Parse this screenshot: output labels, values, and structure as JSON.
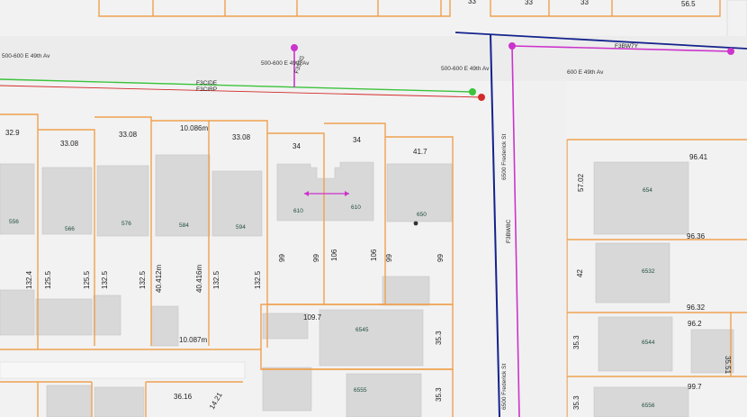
{
  "streets": {
    "e49_left": "500-600 E 49th Av",
    "e49_mid": "500-600 E 49th Av",
    "e49_right": "600 E 49th Av",
    "frederick_north": "6500 Frederick St",
    "frederick_south": "6500 Frederick St"
  },
  "lines": {
    "green_label": "F3CIDE",
    "red_label": "F3CIRP",
    "magenta_label_left": "F3S3G",
    "magenta_label_right": "F3BW7Y",
    "magenta_vertical_label": "F3BW8C",
    "green_color": "#3cc33c",
    "red_color": "#d42a2a",
    "magenta_color": "#cc33cc",
    "navy_color": "#14238c",
    "lot_color": "#f0a14f"
  },
  "addresses": {
    "a556": "556",
    "a566": "566",
    "a576": "576",
    "a584": "584",
    "a594": "594",
    "a610a": "610",
    "a610b": "610",
    "a650": "650",
    "a6545": "6545",
    "a6555": "6555",
    "a654": "654",
    "a6532": "6532",
    "a6544": "6544",
    "a6556": "6556"
  },
  "dimensions": {
    "top_33": "33",
    "top_33b": "33",
    "top_33c": "33",
    "top_565": "56.5",
    "d329": "32.9",
    "d3308a": "33.08",
    "d3308b": "33.08",
    "d10086": "10.086m",
    "d3308c": "33.08",
    "d34a": "34",
    "d34b": "34",
    "d417": "41.7",
    "d1324": "132.4",
    "d1255a": "125.5",
    "d1255b": "125.5",
    "d1325a": "132.5",
    "d1325b": "132.5",
    "d40412": "40.412m",
    "d40416": "40.416m",
    "d1325c": "132.5",
    "d1325d": "132.5",
    "d99a": "99",
    "d99b": "99",
    "d106a": "106",
    "d106b": "106",
    "d99c": "99",
    "d99d": "99",
    "d1097": "109.7",
    "d353a": "35.3",
    "d10087": "10.087m",
    "d353b": "35.3",
    "d3616": "36.16",
    "d1421": "14.21",
    "d9641": "96.41",
    "d5702": "57.02",
    "d9636": "96.36",
    "d42": "42",
    "d9632": "96.32",
    "d962": "96.2",
    "d353c": "35.3",
    "d3551": "35.51",
    "d997": "99.7",
    "d353d": "35.3"
  }
}
